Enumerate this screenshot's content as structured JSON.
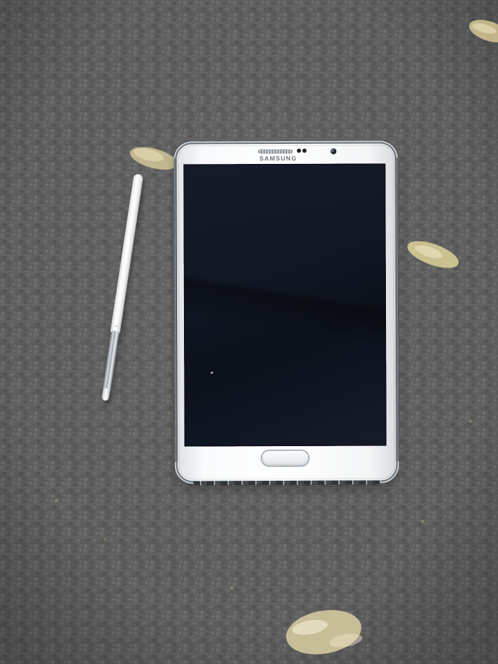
{
  "image": {
    "kind": "photograph",
    "main_colors": {
      "carpet": "#5f5f5f",
      "phone_body": "#f5f6f7",
      "screen": "#111724",
      "stylus": "#f7f7f7",
      "metal_tip": "#a3a7ac",
      "carpet_pattern": "#d5c592"
    },
    "phone": {
      "brand_text": "SAMSUNG"
    }
  }
}
